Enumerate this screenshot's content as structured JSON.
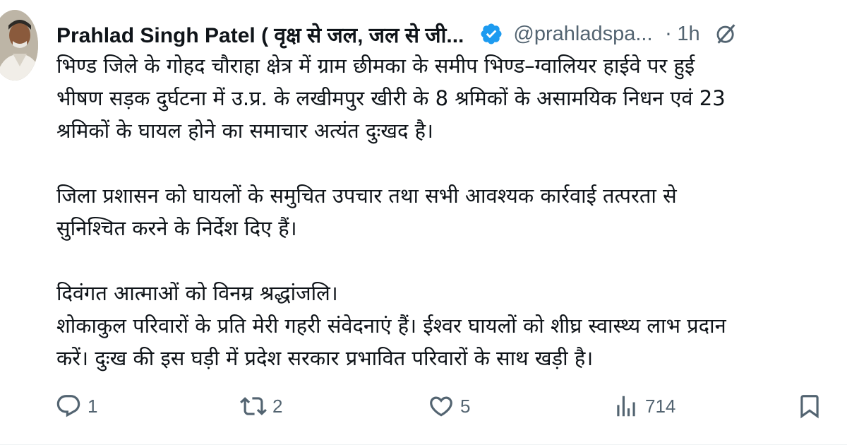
{
  "author": {
    "name": "Prahlad Singh Patel ( वृक्ष से जल, जल से जी...",
    "handle": "@prahladspa...",
    "separator": "·",
    "time": "1h",
    "verified": true,
    "avatar_icon": "profile-photo"
  },
  "tweet": {
    "paragraphs": [
      {
        "lines": [
          "भिण्ड जिले के गोहद चौराहा क्षेत्र में ग्राम छीमका के समीप भिण्ड–ग्वालियर हाईवे पर हुई",
          "भीषण सड़क दुर्घटना में उ.प्र. के लखीमपुर खीरी के 8 श्रमिकों के असामयिक निधन एवं 23",
          "श्रमिकों के घायल होने का समाचार अत्यंत दुःखद है।"
        ]
      },
      {
        "lines": [
          "जिला प्रशासन को घायलों के समुचित उपचार तथा सभी आवश्यक कार्रवाई तत्परता से",
          "सुनिश्चित करने के निर्देश दिए हैं।"
        ]
      },
      {
        "lines": [
          "दिवंगत आत्माओं को विनम्र श्रद्धांजलि।",
          "शोकाकुल परिवारों के प्रति मेरी गहरी संवेदनाएं हैं। ईश्वर घायलों को शीघ्र स्वास्थ्य लाभ प्रदान",
          "करें। दुःख की इस घड़ी में प्रदेश सरकार प्रभावित परिवारों के साथ खड़ी है।"
        ]
      }
    ]
  },
  "actions": {
    "reply": {
      "icon": "reply-icon",
      "count": "1"
    },
    "repost": {
      "icon": "repost-icon",
      "count": "2"
    },
    "like": {
      "icon": "like-icon",
      "count": "5"
    },
    "views": {
      "icon": "views-icon",
      "count": "714"
    },
    "bookmark": {
      "icon": "bookmark-icon"
    }
  },
  "colors": {
    "text_primary": "#0f1419",
    "text_secondary": "#536471",
    "verified_blue": "#1d9bf0"
  }
}
